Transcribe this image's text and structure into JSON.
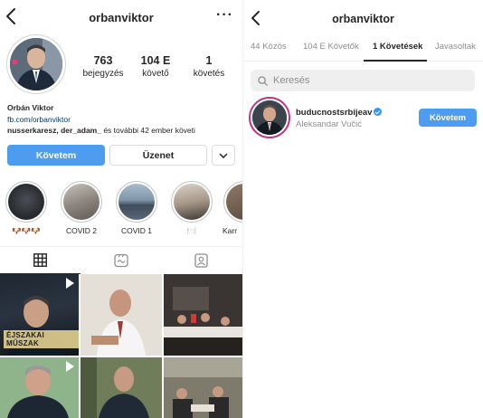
{
  "left": {
    "header": {
      "title": "orbanviktor",
      "more_icon": "more-horizontal-icon"
    },
    "stats": [
      {
        "value": "763",
        "label": "bejegyzés"
      },
      {
        "value": "104 E",
        "label": "követő"
      },
      {
        "value": "1",
        "label": "követés"
      }
    ],
    "bio": {
      "name": "Orbán Viktor",
      "link": "fb.com/orbanviktor",
      "mutual_bold": "nusserkaresz, der_adam_",
      "mutual_rest": " és további 42 ember követi"
    },
    "buttons": {
      "follow": "Követem",
      "message": "Üzenet"
    },
    "highlights": [
      {
        "label": "🐶🐶🐶"
      },
      {
        "label": "COVID 2"
      },
      {
        "label": "COVID 1"
      },
      {
        "label": "🍽️"
      },
      {
        "label": "Karr"
      }
    ],
    "tabs": [
      "grid-icon",
      "reels-icon",
      "tagged-icon"
    ],
    "grid": {
      "overlay_text": "ÉJSZAKAI MŰSZAK"
    }
  },
  "right": {
    "header": {
      "title": "orbanviktor"
    },
    "tabs": [
      {
        "label": "44 Közös",
        "active": false
      },
      {
        "label": "104 E Követők",
        "active": false
      },
      {
        "label": "1 Követések",
        "active": true
      },
      {
        "label": "Javasoltak",
        "active": false
      }
    ],
    "search": {
      "placeholder": "Keresés"
    },
    "following": [
      {
        "handle": "buducnostsrbijeav",
        "name": "Aleksandar Vučić",
        "verified": true,
        "button": "Követem"
      }
    ]
  },
  "colors": {
    "accent": "#4c9cf0",
    "verified": "#3897f0",
    "muted": "#8e8e8e",
    "link": "#00376b"
  }
}
